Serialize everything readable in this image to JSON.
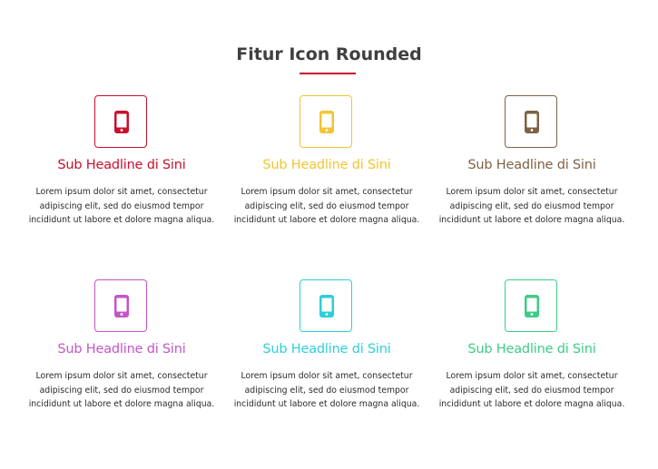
{
  "section": {
    "title": "Fitur Icon Rounded",
    "accent_color": "#c8102e"
  },
  "features": [
    {
      "icon": "smartphone-icon",
      "color": "#c8102e",
      "title": "Sub Headline di Sini",
      "text": "Lorem ipsum dolor sit amet, consectetur adipiscing elit, sed do eiusmod tempor incididunt ut labore et dolore magna aliqua."
    },
    {
      "icon": "smartphone-icon",
      "color": "#f2c531",
      "title": "Sub Headline di Sini",
      "text": "Lorem ipsum dolor sit amet, consectetur adipiscing elit, sed do eiusmod tempor incididunt ut labore et dolore magna aliqua."
    },
    {
      "icon": "smartphone-icon",
      "color": "#7d6244",
      "title": "Sub Headline di Sini",
      "text": "Lorem ipsum dolor sit amet, consectetur adipiscing elit, sed do eiusmod tempor incididunt ut labore et dolore magna aliqua."
    },
    {
      "icon": "smartphone-icon",
      "color": "#c455c9",
      "title": "Sub Headline di Sini",
      "text": "Lorem ipsum dolor sit amet, consectetur adipiscing elit, sed do eiusmod tempor incididunt ut labore et dolore magna aliqua."
    },
    {
      "icon": "smartphone-icon",
      "color": "#2ccfdb",
      "title": "Sub Headline di Sini",
      "text": "Lorem ipsum dolor sit amet, consectetur adipiscing elit, sed do eiusmod tempor incididunt ut labore et dolore magna aliqua."
    },
    {
      "icon": "smartphone-icon",
      "color": "#3fcb86",
      "title": "Sub Headline di Sini",
      "text": "Lorem ipsum dolor sit amet, consectetur adipiscing elit, sed do eiusmod tempor incididunt ut labore et dolore magna aliqua."
    }
  ]
}
